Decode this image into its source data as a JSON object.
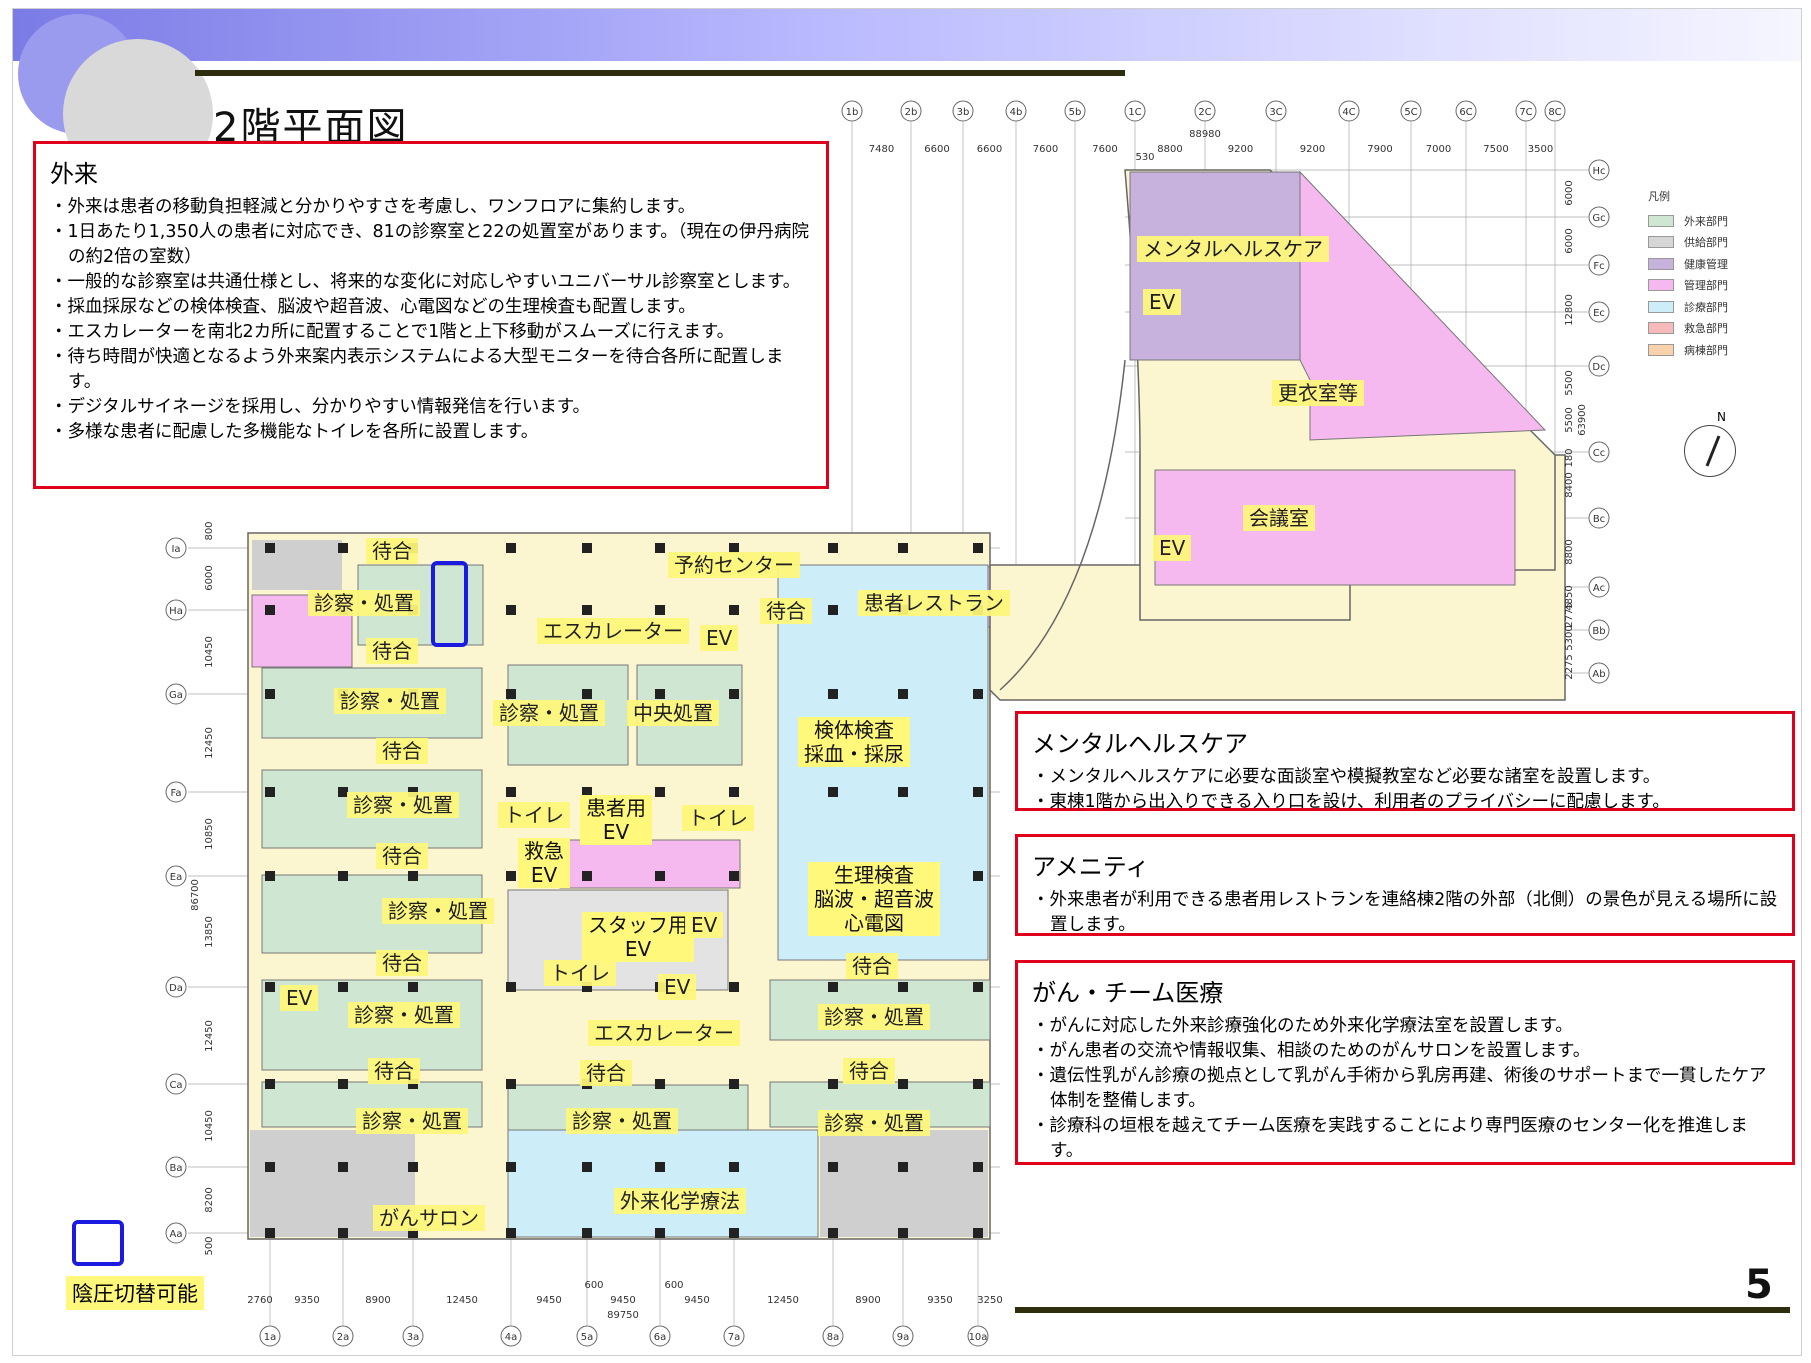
{
  "title": "2階平面図",
  "page_number": "5",
  "outpatient": {
    "heading": "外来",
    "items": [
      "外来は患者の移動負担軽減と分かりやすさを考慮し、ワンフロアに集約します。",
      "1日あたり1,350人の患者に対応でき、81の診察室と22の処置室があります。（現在の伊丹病院の約2倍の室数）",
      "一般的な診察室は共通仕様とし、将来的な変化に対応しやすいユニバーサル診察室とします。",
      "採血採尿などの検体検査、脳波や超音波、心電図などの生理検査も配置します。",
      "エスカレーターを南北2カ所に配置することで1階と上下移動がスムーズに行えます。",
      "待ち時間が快適となるよう外来案内表示システムによる大型モニターを待合各所に配置します。",
      "デジタルサイネージを採用し、分かりやすい情報発信を行います。",
      "多様な患者に配慮した多機能なトイレを各所に設置します。"
    ]
  },
  "mental": {
    "heading": "メンタルヘルスケア",
    "items": [
      "メンタルヘルスケアに必要な面談室や模擬教室など必要な諸室を設置します。",
      "東棟1階から出入りできる入り口を設け、利用者のプライバシーに配慮します。"
    ]
  },
  "amenity": {
    "heading": "アメニティ",
    "items": [
      "外来患者が利用できる患者用レストランを連絡棟2階の外部（北側）の景色が見える場所に設置します。"
    ]
  },
  "cancer": {
    "heading": "がん・チーム医療",
    "items": [
      "がんに対応した外来診療強化のため外来化学療法室を設置します。",
      "がん患者の交流や情報収集、相談のためのがんサロンを設置します。",
      "遺伝性乳がん診療の拠点として乳がん手術から乳房再建、術後のサポートまで一貫したケア体制を整備します。",
      "診療科の垣根を越えてチーム医療を実践することにより専門医療のセンター化を推進します。"
    ]
  },
  "legend": {
    "title": "凡例",
    "items": [
      {
        "label": "外来部門",
        "color": "#cfe6d2"
      },
      {
        "label": "供給部門",
        "color": "#d6d6d6"
      },
      {
        "label": "健康管理",
        "color": "#c6b2dc"
      },
      {
        "label": "管理部門",
        "color": "#f5b8ef"
      },
      {
        "label": "診療部門",
        "color": "#cdeef9"
      },
      {
        "label": "救急部門",
        "color": "#f7b9b9"
      },
      {
        "label": "病棟部門",
        "color": "#f9d2ac"
      }
    ]
  },
  "key": {
    "label": "陰圧切替可能"
  },
  "compass": "N",
  "labels": {
    "waiting": "待合",
    "exam": "診察・処置",
    "reservation": "予約センター",
    "escalator": "エスカレーター",
    "ev": "EV",
    "restaurant": "患者レストラン",
    "central": "中央処置",
    "specimen": "検体検査\n採血・採尿",
    "toilet": "トイレ",
    "patient_ev": "患者用\nEV",
    "emergency_ev": "救急\nEV",
    "staff_ev": "スタッフ用\nEV",
    "physio": "生理検査\n脳波・超音波\n心電図",
    "chemo": "外来化学療法",
    "salon": "がんサロン",
    "mental": "メンタルヘルスケア",
    "locker": "更衣室等",
    "meeting": "会議室"
  },
  "grid": {
    "top_axes": [
      "1b",
      "2b",
      "3b",
      "4b",
      "5b",
      "1C",
      "2C",
      "3C",
      "4C",
      "5C",
      "6C",
      "7C",
      "8C"
    ],
    "top_dims": [
      "7480",
      "6600",
      "6600",
      "7600",
      "7600",
      "8800",
      "9200",
      "9200",
      "7900",
      "7000",
      "7500",
      "3500"
    ],
    "top_total": "88980",
    "top_small": "530",
    "bottom_axes": [
      "1a",
      "2a",
      "3a",
      "4a",
      "5a",
      "6a",
      "7a",
      "8a",
      "9a",
      "10a"
    ],
    "bottom_dims": [
      "2760",
      "9350",
      "8900",
      "12450",
      "9450",
      "9450",
      "9450",
      "12450",
      "8900",
      "9350",
      "3250"
    ],
    "bottom_total": "89750",
    "bottom_small": [
      "600",
      "600"
    ],
    "left_axes": [
      "Ia",
      "Ha",
      "Ga",
      "Fa",
      "Ea",
      "Da",
      "Ca",
      "Ba",
      "Aa"
    ],
    "left_dims": [
      "800",
      "6000",
      "10450",
      "12450",
      "10850",
      "13850",
      "12450",
      "10450",
      "8200",
      "500"
    ],
    "left_total": "86700",
    "right_axes": [
      "Hc",
      "Gc",
      "Fc",
      "Ec",
      "Dc",
      "Cc",
      "Bc",
      "Ac",
      "Bb",
      "Ab"
    ],
    "right_dims": [
      "6000",
      "6000",
      "12800",
      "5500",
      "5500",
      "180",
      "8400",
      "8800",
      "4850",
      "2775",
      "5300",
      "2275"
    ],
    "right_total": "63900"
  }
}
